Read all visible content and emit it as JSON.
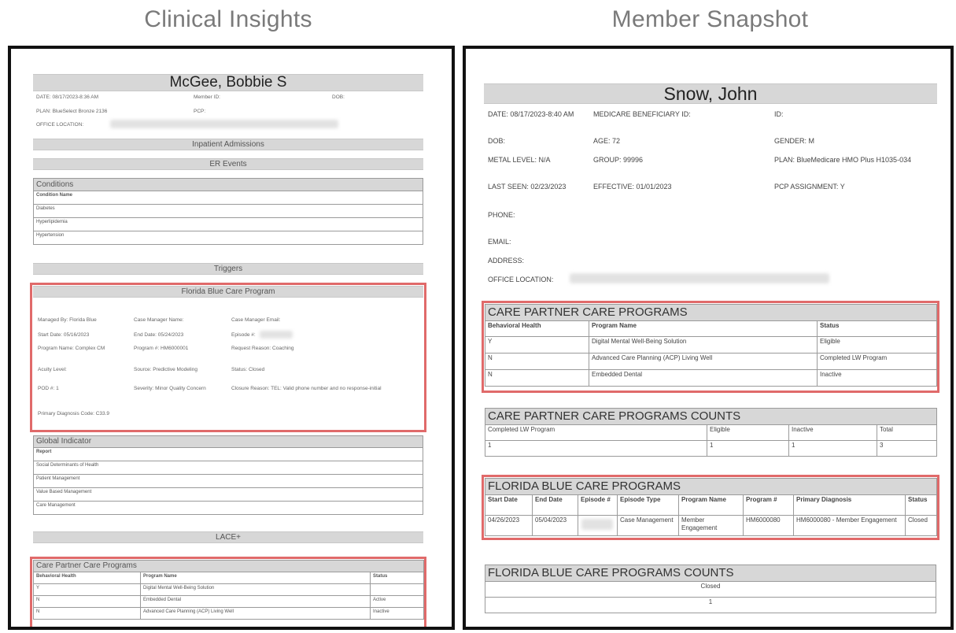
{
  "titles": {
    "left": "Clinical Insights",
    "right": "Member Snapshot"
  },
  "left": {
    "name": "McGee, Bobbie S",
    "header": {
      "date": "DATE: 08/17/2023-8:36 AM",
      "member_id": "Member ID:",
      "dob": "DOB:",
      "plan": "PLAN: BlueSelect Bronze 2136",
      "pcp": "PCP:",
      "office": "OFFICE LOCATION:"
    },
    "sections": {
      "inpatient": "Inpatient Admissions",
      "er": "ER Events",
      "conditions": "Conditions",
      "triggers": "Triggers",
      "fbcp": "Florida Blue Care Program",
      "global": "Global Indicator",
      "lace": "LACE+",
      "cpcp": "Care Partner Care Programs"
    },
    "conditions": {
      "header": "Condition Name",
      "rows": [
        "Diabetes",
        "Hyperlipidemia",
        "Hypertension"
      ]
    },
    "fbcp": {
      "managed_by": "Managed By: Florida Blue",
      "case_manager_name": "Case Manager Name:",
      "case_manager_email": "Case Manager Email:",
      "start_date": "Start Date: 05/16/2023",
      "end_date": "End Date: 05/24/2023",
      "episode": "Episode #:",
      "program_name": "Program Name: Complex CM",
      "program_num": "Program #: HM6000001",
      "request_reason": "Request Reason: Coaching",
      "acuity": "Acuity Level:",
      "source": "Source: Predictive Modeling",
      "status": "Status: Closed",
      "pod": "POD #: 1",
      "severity": "Severity: Minor Quality Concern",
      "closure": "Closure Reason: TEL: Valid phone number and no response-initial",
      "primary_dx": "Primary Diagnosis Code: C33.9"
    },
    "global": {
      "header": "Report",
      "rows": [
        "Social Determinants of Health",
        "Patient Management",
        "Value Based Management",
        "Care Management"
      ]
    },
    "cpcp": {
      "headers": [
        "Behavioral Health",
        "Program Name",
        "Status"
      ],
      "rows": [
        [
          "Y",
          "Digital Mental Well-Being Solution",
          ""
        ],
        [
          "N",
          "Embedded Dental",
          "Active"
        ],
        [
          "N",
          "Advanced Care Planning (ACP) Living Well",
          "Inactive"
        ]
      ]
    }
  },
  "right": {
    "name": "Snow, John",
    "fields": {
      "date": "DATE: 08/17/2023-8:40 AM",
      "medicare_id": "MEDICARE BENEFICIARY ID:",
      "id": "ID:",
      "dob": "DOB:",
      "age": "AGE: 72",
      "gender": "GENDER: M",
      "metal": "METAL LEVEL: N/A",
      "group": "GROUP: 99996",
      "plan": "PLAN: BlueMedicare HMO Plus H1035-034",
      "last_seen": "LAST SEEN: 02/23/2023",
      "effective": "EFFECTIVE: 01/01/2023",
      "pcp_assign": "PCP ASSIGNMENT: Y",
      "phone": "PHONE:",
      "email": "EMAIL:",
      "address": "ADDRESS:",
      "office": "OFFICE LOCATION:"
    },
    "cpcp": {
      "title": "CARE PARTNER CARE PROGRAMS",
      "headers": [
        "Behavioral Health",
        "Program Name",
        "Status"
      ],
      "rows": [
        [
          "Y",
          "Digital Mental Well-Being Solution",
          "Eligible"
        ],
        [
          "N",
          "Advanced Care Planning (ACP) Living Well",
          "Completed LW Program"
        ],
        [
          "N",
          "Embedded Dental",
          "Inactive"
        ]
      ]
    },
    "cpcp_counts": {
      "title": "CARE PARTNER CARE PROGRAMS COUNTS",
      "headers": [
        "Completed LW Program",
        "Eligible",
        "Inactive",
        "Total"
      ],
      "values": [
        "1",
        "1",
        "1",
        "3"
      ]
    },
    "fbcp": {
      "title": "FLORIDA BLUE CARE PROGRAMS",
      "headers": [
        "Start Date",
        "End Date",
        "Episode #",
        "Episode Type",
        "Program Name",
        "Program #",
        "Primary Diagnosis",
        "Status"
      ],
      "row": [
        "04/26/2023",
        "05/04/2023",
        "",
        "Case Management",
        "Member Engagement",
        "HM6000080",
        "HM6000080 - Member Engagement",
        "Closed"
      ]
    },
    "fbcp_counts": {
      "title": "FLORIDA BLUE CARE PROGRAMS COUNTS",
      "header": "Closed",
      "value": "1"
    }
  }
}
